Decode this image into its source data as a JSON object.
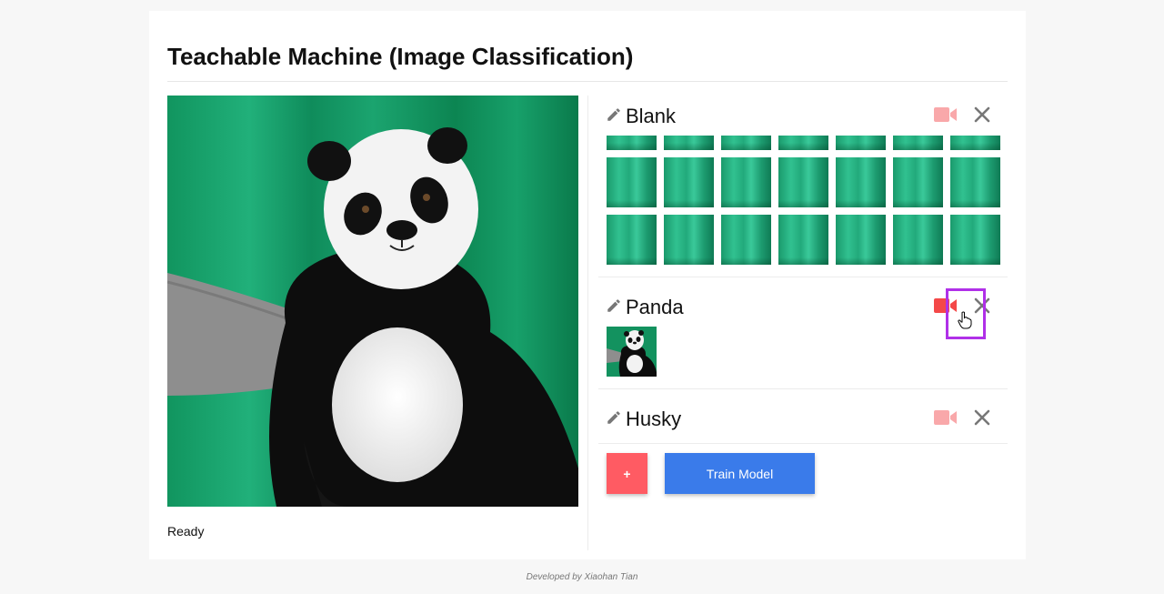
{
  "app": {
    "title": "Teachable Machine (Image Classification)",
    "status": "Ready",
    "footer": "Developed by Xiaohan Tian"
  },
  "colors": {
    "accent_blue": "#3a7bea",
    "add_red": "#ff5b63",
    "camera_inactive": "#f9a8aa",
    "camera_active": "#f44848",
    "highlight_purple": "#b030e8"
  },
  "classes": [
    {
      "name": "Blank",
      "camera_icon": "video-camera-icon",
      "camera_active": false,
      "sample_count": 21
    },
    {
      "name": "Panda",
      "camera_icon": "video-camera-icon",
      "camera_active": true,
      "sample_count": 1
    },
    {
      "name": "Husky",
      "camera_icon": "video-camera-icon",
      "camera_active": false,
      "sample_count": 0
    }
  ],
  "actions": {
    "add_label": "+",
    "train_label": "Train Model"
  }
}
